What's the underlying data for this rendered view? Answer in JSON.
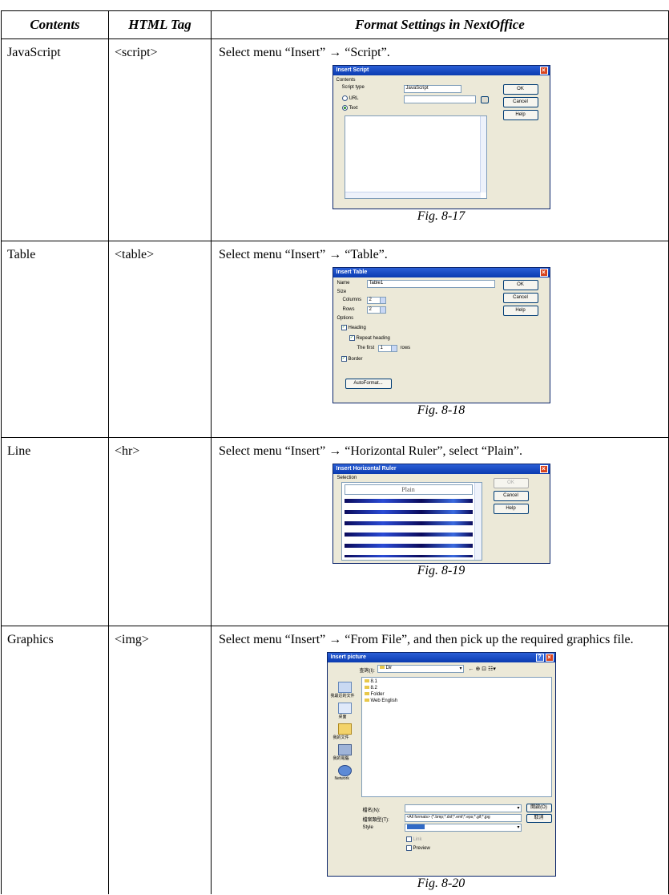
{
  "headers": [
    "Contents",
    "HTML Tag",
    "Format Settings in NextOffice"
  ],
  "rows": [
    {
      "content": "JavaScript",
      "tag": "<script>",
      "instruction": "Select menu “Insert” → “Script”.",
      "caption": "Fig. 8-17",
      "dialog": {
        "title": "Insert Script",
        "group": "Contents",
        "script_type_label": "Script type",
        "script_type_value": "JavaScript",
        "url_label": "URL",
        "text_label": "Text",
        "ok": "OK",
        "cancel": "Cancel",
        "help": "Help"
      }
    },
    {
      "content": "Table",
      "tag": "<table>",
      "instruction": "Select menu “Insert” → “Table”.",
      "caption": "Fig. 8-18",
      "dialog": {
        "title": "Insert Table",
        "name_label": "Name",
        "name_value": "Table1",
        "size_label": "Size",
        "columns_label": "Columns",
        "columns_value": "2",
        "rows_label": "Rows",
        "rows_value": "2",
        "options_label": "Options",
        "heading": "Heading",
        "repeat_heading": "Repeat heading",
        "the_first": "The first",
        "the_first_value": "1",
        "rows_unit": "rows",
        "border": "Border",
        "autoformat": "AutoFormat...",
        "ok": "OK",
        "cancel": "Cancel",
        "help": "Help"
      }
    },
    {
      "content": "Line",
      "tag": "<hr>",
      "instruction": "Select menu “Insert” → “Horizontal Ruler”, select “Plain”.",
      "caption": "Fig. 8-19",
      "dialog": {
        "title": "Insert Horizontal Ruler",
        "group": "Selection",
        "selected": "Plain",
        "ok": "OK",
        "cancel": "Cancel",
        "help": "Help"
      }
    },
    {
      "content": "Graphics",
      "tag": "<img>",
      "instruction": "Select menu “Insert” → “From File”, and then pick up the required graphics file.",
      "caption": "Fig. 8-20",
      "dialog": {
        "title": "Insert picture",
        "lookin_label": "查詢(I):",
        "lookin_value": "Dir",
        "folders": [
          "8.1",
          "8.2",
          "Folder",
          "Web English"
        ],
        "places": [
          "我最近的文件",
          "桌面",
          "我的文件",
          "我的電腦",
          "Network"
        ],
        "filename_label": "檔名(N):",
        "filetype_label": "檔案類型(T):",
        "filetype_value": "<All formats> (*.bmp;*.dxf;*.emf;*.eps;*.gif;*.jpg",
        "style_label": "Style",
        "link_label": "Link",
        "preview_label": "Preview",
        "open": "開啟(O)",
        "cancel": "取消"
      }
    }
  ]
}
